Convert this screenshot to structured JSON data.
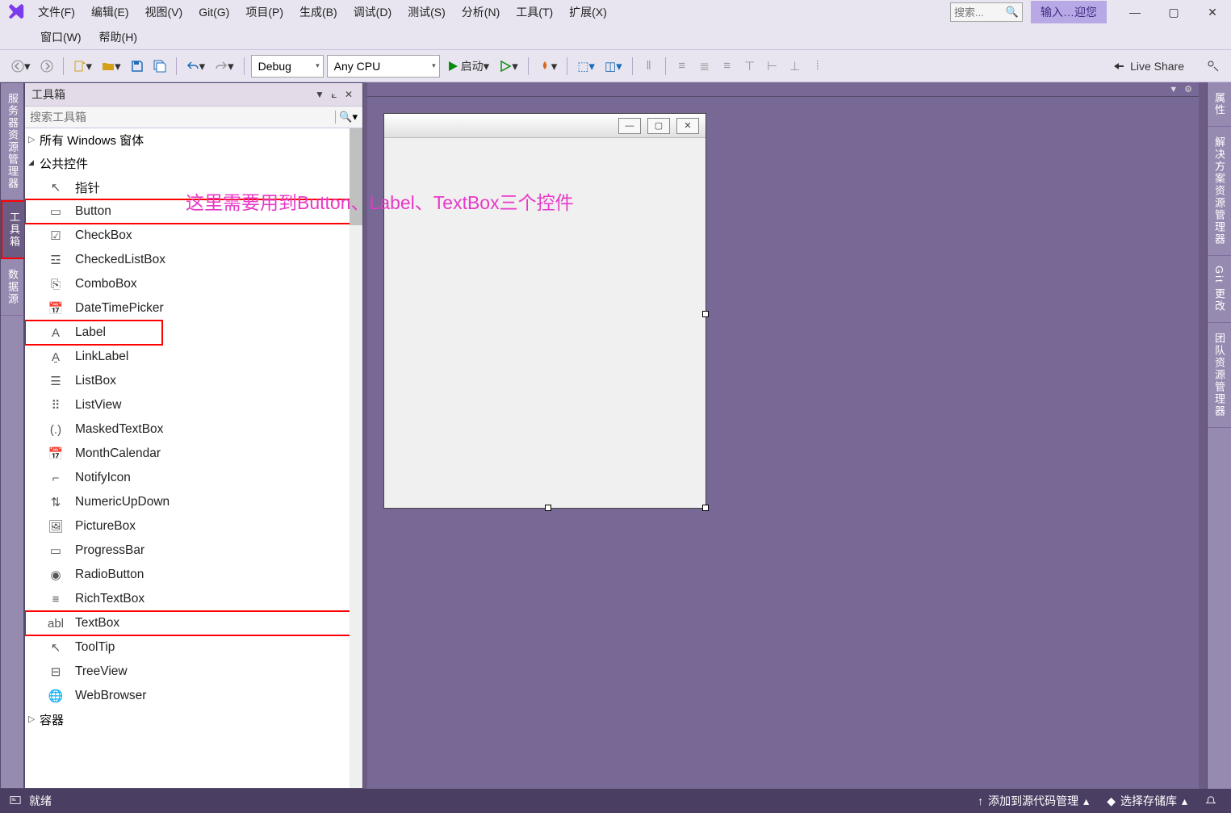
{
  "menu": {
    "items": [
      "文件(F)",
      "编辑(E)",
      "视图(V)",
      "Git(G)",
      "项目(P)",
      "生成(B)",
      "调试(D)",
      "测试(S)",
      "分析(N)",
      "工具(T)",
      "扩展(X)"
    ],
    "secondRow": [
      "窗口(W)",
      "帮助(H)"
    ],
    "searchPlaceholder": "搜索...",
    "welcome": "输入…迎您"
  },
  "toolbar": {
    "config": "Debug",
    "platform": "Any CPU",
    "start": "启动",
    "liveshare": "Live Share"
  },
  "leftTabs": [
    "服务器资源管理器",
    "工具箱",
    "数据源"
  ],
  "rightTabs": [
    "属性",
    "解决方案资源管理器",
    "Git 更改",
    "团队资源管理器"
  ],
  "toolbox": {
    "title": "工具箱",
    "searchPlaceholder": "搜索工具箱",
    "groups": [
      {
        "name": "所有 Windows 窗体",
        "open": false
      },
      {
        "name": "公共控件",
        "open": true,
        "items": [
          {
            "icon": "↖",
            "label": "指针"
          },
          {
            "icon": "▭",
            "label": "Button",
            "hl": true
          },
          {
            "icon": "☑",
            "label": "CheckBox"
          },
          {
            "icon": "☲",
            "label": "CheckedListBox"
          },
          {
            "icon": "⎘",
            "label": "ComboBox"
          },
          {
            "icon": "📅",
            "label": "DateTimePicker"
          },
          {
            "icon": "A",
            "label": "Label",
            "hl": true,
            "narrow": true
          },
          {
            "icon": "A̱",
            "label": "LinkLabel"
          },
          {
            "icon": "☰",
            "label": "ListBox"
          },
          {
            "icon": "⠿",
            "label": "ListView"
          },
          {
            "icon": "(.)",
            "label": "MaskedTextBox"
          },
          {
            "icon": "📅",
            "label": "MonthCalendar"
          },
          {
            "icon": "⌐",
            "label": "NotifyIcon"
          },
          {
            "icon": "⇅",
            "label": "NumericUpDown"
          },
          {
            "icon": "🖼",
            "label": "PictureBox"
          },
          {
            "icon": "▭",
            "label": "ProgressBar"
          },
          {
            "icon": "◉",
            "label": "RadioButton"
          },
          {
            "icon": "≡",
            "label": "RichTextBox"
          },
          {
            "icon": "abl",
            "label": "TextBox",
            "hl": true
          },
          {
            "icon": "↖",
            "label": "ToolTip"
          },
          {
            "icon": "⊟",
            "label": "TreeView"
          },
          {
            "icon": "🌐",
            "label": "WebBrowser"
          }
        ]
      },
      {
        "name": "容器",
        "open": false
      }
    ]
  },
  "annotation": "这里需要用到Button、Label、TextBox三个控件",
  "status": {
    "ready": "就绪",
    "src": "添加到源代码管理",
    "repo": "选择存储库"
  }
}
